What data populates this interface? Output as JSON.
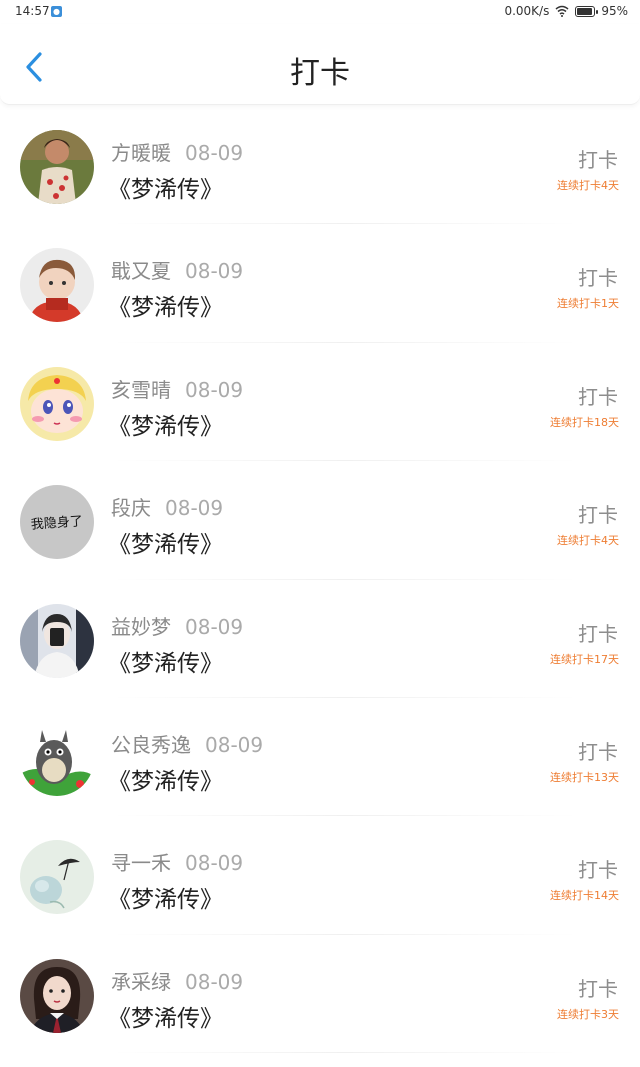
{
  "status_bar": {
    "time": "14:57",
    "speed": "0.00K/s",
    "battery": "95%",
    "battery_level": 0.95
  },
  "header": {
    "title": "打卡",
    "back_icon": "chevron-left-icon"
  },
  "colors": {
    "accent": "#2b8fe0",
    "streak": "#ee7d33"
  },
  "entries": [
    {
      "name": "方暖暖",
      "date": "08-09",
      "book": "《梦浠传》",
      "action": "打卡",
      "streak": "连续打卡4天"
    },
    {
      "name": "戢又夏",
      "date": "08-09",
      "book": "《梦浠传》",
      "action": "打卡",
      "streak": "连续打卡1天"
    },
    {
      "name": "亥雪晴",
      "date": "08-09",
      "book": "《梦浠传》",
      "action": "打卡",
      "streak": "连续打卡18天"
    },
    {
      "name": "段庆",
      "date": "08-09",
      "book": "《梦浠传》",
      "action": "打卡",
      "streak": "连续打卡4天",
      "avatar_text": "我隐身了"
    },
    {
      "name": "益妙梦",
      "date": "08-09",
      "book": "《梦浠传》",
      "action": "打卡",
      "streak": "连续打卡17天"
    },
    {
      "name": "公良秀逸",
      "date": "08-09",
      "book": "《梦浠传》",
      "action": "打卡",
      "streak": "连续打卡13天"
    },
    {
      "name": "寻一禾",
      "date": "08-09",
      "book": "《梦浠传》",
      "action": "打卡",
      "streak": "连续打卡14天"
    },
    {
      "name": "承采绿",
      "date": "08-09",
      "book": "《梦浠传》",
      "action": "打卡",
      "streak": "连续打卡3天"
    }
  ]
}
